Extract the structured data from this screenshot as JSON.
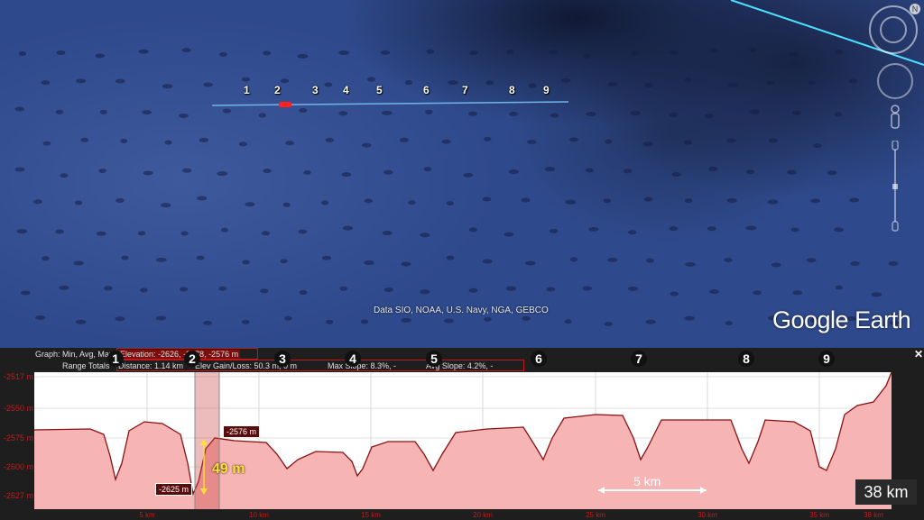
{
  "map": {
    "markers": [
      "1",
      "2",
      "3",
      "4",
      "5",
      "6",
      "7",
      "8",
      "9"
    ],
    "credit": "Data SIO, NOAA, U.S. Navy, NGA, GEBCO",
    "logo": "Google Earth"
  },
  "profile": {
    "header": {
      "graph_label": "Graph: Min, Avg, Max",
      "elevation": "Elevation: -2626, -2578, -2576 m",
      "range_label": "Range Totals",
      "distance": "Distance: 1.14 km",
      "elev_gain": "Elev Gain/Loss: 50.3 m, 0 m",
      "max_slope": "Max Slope: 8.3%, -",
      "avg_slope": "Avg Slope: 4.2%, -"
    },
    "markers": [
      "1",
      "2",
      "3",
      "4",
      "5",
      "6",
      "7",
      "8",
      "9"
    ],
    "y_ticks": [
      "-2517 m",
      "-2550 m",
      "-2575 m",
      "-2600 m",
      "-2627 m"
    ],
    "x_ticks": [
      "5 km",
      "10 km",
      "15 km",
      "20 km",
      "25 km",
      "30 km",
      "35 km",
      "38 km"
    ],
    "low_tag": "-2625 m",
    "high_tag": "-2576 m",
    "diff_label": "49 m",
    "scale_label": "5 km",
    "total_distance": "38 km",
    "close_icon": "✕",
    "colors": {
      "line": "#8b1010",
      "fill": "#f6b4b4",
      "accent": "#c01818",
      "highlight": "#ffe033"
    }
  }
}
